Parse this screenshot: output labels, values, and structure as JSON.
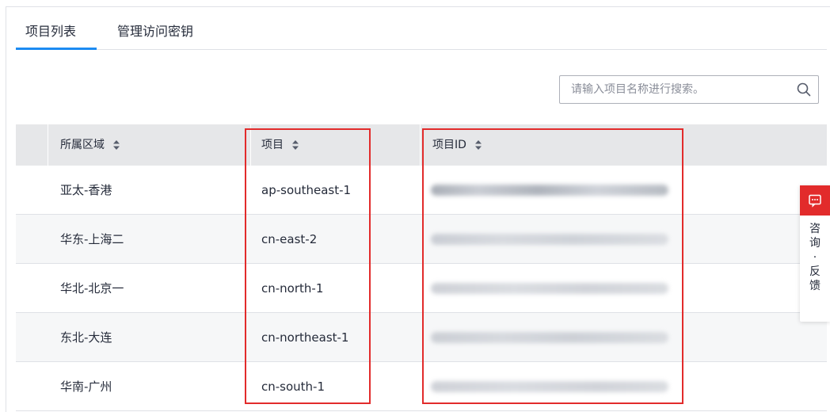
{
  "tabs": [
    {
      "label": "项目列表",
      "active": true
    },
    {
      "label": "管理访问密钥",
      "active": false
    }
  ],
  "search": {
    "placeholder": "请输入项目名称进行搜索。",
    "icon": "search-icon"
  },
  "table": {
    "headers": [
      "所属区域",
      "项目",
      "项目ID"
    ],
    "rows": [
      {
        "region": "亚太-香港",
        "project": "ap-southeast-1",
        "project_id_redacted": true
      },
      {
        "region": "华东-上海二",
        "project": "cn-east-2",
        "project_id_redacted": true
      },
      {
        "region": "华北-北京一",
        "project": "cn-north-1",
        "project_id_redacted": true
      },
      {
        "region": "东北-大连",
        "project": "cn-northeast-1",
        "project_id_redacted": true
      },
      {
        "region": "华南-广州",
        "project": "cn-south-1",
        "project_id_redacted": true
      }
    ]
  },
  "float_button": {
    "icon": "chat-icon",
    "chars": [
      "咨",
      "询",
      "·",
      "反",
      "馈"
    ]
  },
  "colors": {
    "accent": "#1c8bf2",
    "highlight": "#e22b2b",
    "header_bg": "#e6e7e9"
  }
}
